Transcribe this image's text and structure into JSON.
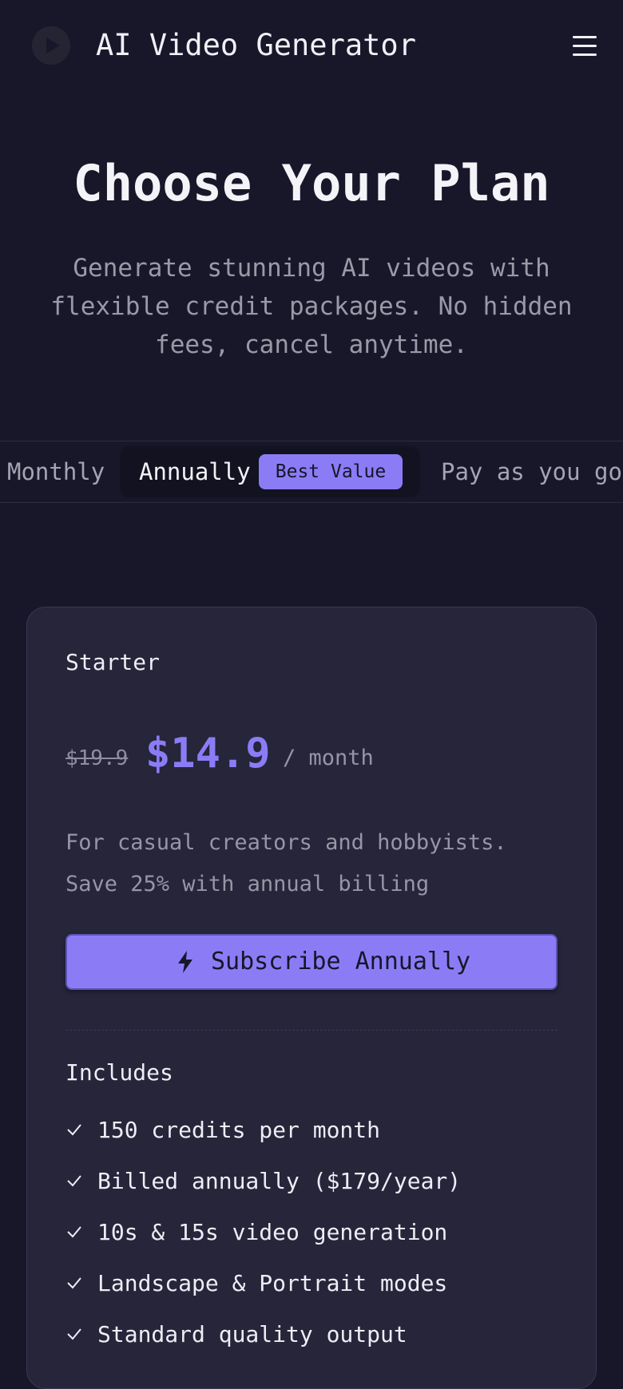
{
  "header": {
    "app_title": "AI Video Generator",
    "logo_icon": "play-icon",
    "menu_icon": "hamburger-menu-icon"
  },
  "hero": {
    "title": "Choose Your Plan",
    "subtitle": "Generate stunning AI videos with flexible credit packages. No hidden fees, cancel anytime."
  },
  "billing_tabs": {
    "monthly": "Monthly",
    "annually": "Annually",
    "annually_badge": "Best Value",
    "pay_as_you_go": "Pay as you go",
    "selected": "Annually"
  },
  "plan": {
    "name": "Starter",
    "old_price": "$19.9",
    "price": "$14.9",
    "period": "/ month",
    "description_line1": "For casual creators and hobbyists.",
    "description_line2": "Save 25% with annual billing",
    "cta_label": "Subscribe Annually",
    "cta_icon": "lightning-bolt-icon",
    "includes_label": "Includes",
    "features": [
      "150 credits per month",
      "Billed annually ($179/year)",
      "10s & 15s video generation",
      "Landscape & Portrait modes",
      "Standard quality output"
    ]
  },
  "colors": {
    "background": "#18172a",
    "card": "#26253a",
    "accent": "#8b7cf6",
    "muted_text": "#9796a5"
  }
}
